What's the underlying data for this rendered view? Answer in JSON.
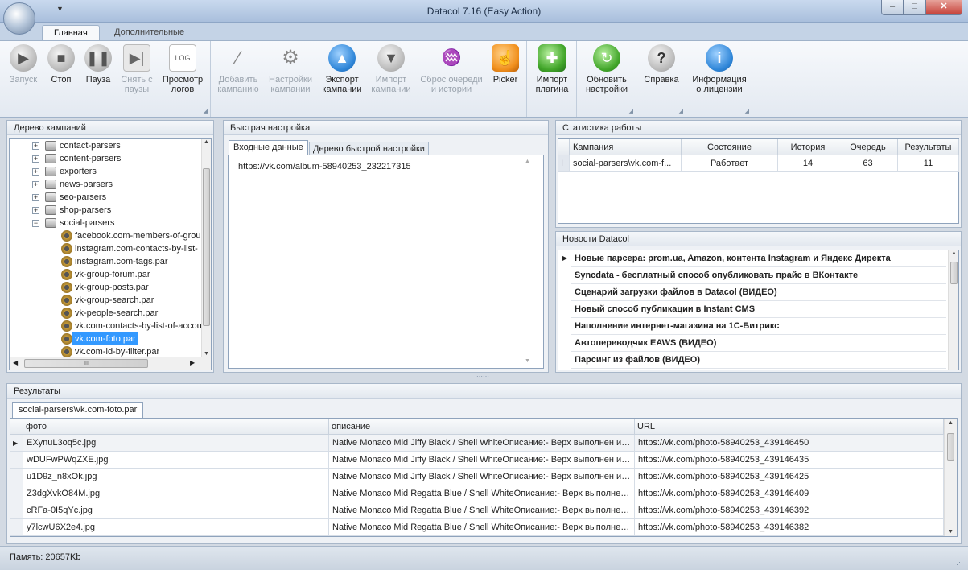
{
  "window": {
    "title": "Datacol 7.16 (Easy Action)",
    "minimize": "–",
    "maximize": "□",
    "close": "✕"
  },
  "ribbon": {
    "tabs": [
      "Главная",
      "Дополнительные"
    ],
    "buttons": {
      "start": {
        "line1": "Запуск",
        "line2": "",
        "icon": "play-icon"
      },
      "stop": {
        "line1": "Стоп",
        "line2": "",
        "icon": "stop-icon"
      },
      "pause": {
        "line1": "Пауза",
        "line2": "",
        "icon": "pause-icon"
      },
      "unpause": {
        "line1": "Снять с",
        "line2": "паузы",
        "icon": "resume-icon"
      },
      "logs": {
        "line1": "Просмотр",
        "line2": "логов",
        "icon": "log-icon"
      },
      "add_campaign": {
        "line1": "Добавить",
        "line2": "кампанию",
        "icon": "magic-wand-icon"
      },
      "campaign_settings": {
        "line1": "Настройки",
        "line2": "кампании",
        "icon": "gear-icon"
      },
      "export": {
        "line1": "Экспорт",
        "line2": "кампании",
        "icon": "arrow-up-icon"
      },
      "import": {
        "line1": "Импорт",
        "line2": "кампании",
        "icon": "arrow-down-icon"
      },
      "reset_queue": {
        "line1": "Сброс очереди",
        "line2": "и истории",
        "icon": "broom-icon"
      },
      "picker": {
        "line1": "Picker",
        "line2": "",
        "icon": "hand-pointer-icon"
      },
      "import_plugin": {
        "line1": "Импорт",
        "line2": "плагина",
        "icon": "puzzle-icon"
      },
      "update_settings": {
        "line1": "Обновить",
        "line2": "настройки",
        "icon": "refresh-icon"
      },
      "help": {
        "line1": "Справка",
        "line2": "",
        "icon": "help-icon"
      },
      "license": {
        "line1": "Информация",
        "line2": "о лицензии",
        "icon": "info-icon"
      }
    }
  },
  "tree_panel": {
    "title": "Дерево кампаний",
    "folders": [
      "contact-parsers",
      "content-parsers",
      "exporters",
      "news-parsers",
      "seo-parsers",
      "shop-parsers",
      "social-parsers"
    ],
    "items": [
      "facebook.com-members-of-grou",
      "instagram.com-contacts-by-list-",
      "instagram.com-tags.par",
      "vk-group-forum.par",
      "vk-group-posts.par",
      "vk-group-search.par",
      "vk-people-search.par",
      "vk.com-contacts-by-list-of-accou",
      "vk.com-foto.par",
      "vk.com-id-by-filter.par"
    ],
    "selected": "vk.com-foto.par",
    "hscroll_grip": "III"
  },
  "quick_settings": {
    "title": "Быстрая настройка",
    "tabs": [
      "Входные данные",
      "Дерево быстрой настройки"
    ],
    "input_text": "https://vk.com/album-58940253_232217315"
  },
  "stats": {
    "title": "Статистика работы",
    "columns": [
      "Кампания",
      "Состояние",
      "История",
      "Очередь",
      "Результаты"
    ],
    "row_marker": "I",
    "rows": [
      [
        "social-parsers\\vk.com-f...",
        "Работает",
        "14",
        "63",
        "11"
      ]
    ]
  },
  "news": {
    "title": "Новости Datacol",
    "items": [
      "Новые парсера: prom.ua, Amazon, контента Instagram и Яндекс Директа",
      "Syncdata - бесплатный способ опубликовать прайс в ВКонтакте",
      "Сценарий загрузки файлов в Datacol (ВИДЕО)",
      "Новый способ публикации в Instant CMS",
      "Наполнение интернет-магазина на 1С-Битрикс",
      "Автопереводчик EAWS (ВИДЕО)",
      "Парсинг из файлов (ВИДЕО)"
    ]
  },
  "results": {
    "title": "Результаты",
    "tab": "social-parsers\\vk.com-foto.par",
    "columns": [
      "фото",
      "описание",
      "URL"
    ],
    "rows": [
      [
        "EXynuL3oq5c.jpg",
        "Native Monaco Mid Jiffy Black / Shell WhiteОписание:- Верх выполнен из ...",
        "https://vk.com/photo-58940253_439146450"
      ],
      [
        "wDUFwPWqZXE.jpg",
        "Native Monaco Mid Jiffy Black / Shell WhiteОписание:- Верх выполнен из ...",
        "https://vk.com/photo-58940253_439146435"
      ],
      [
        "u1D9z_n8xOk.jpg",
        "Native Monaco Mid Jiffy Black / Shell WhiteОписание:- Верх выполнен из ...",
        "https://vk.com/photo-58940253_439146425"
      ],
      [
        "Z3dgXvkO84M.jpg",
        "Native Monaco Mid Regatta Blue / Shell WhiteОписание:- Верх выполнен ...",
        "https://vk.com/photo-58940253_439146409"
      ],
      [
        "cRFa-0I5qYc.jpg",
        "Native Monaco Mid Regatta Blue / Shell WhiteОписание:- Верх выполнен ...",
        "https://vk.com/photo-58940253_439146392"
      ],
      [
        "y7lcwU6X2e4.jpg",
        "Native Monaco Mid Regatta Blue / Shell WhiteОписание:- Верх выполнен ...",
        "https://vk.com/photo-58940253_439146382"
      ]
    ]
  },
  "status": {
    "memory": "Память: 20657Kb"
  },
  "colors": {
    "accent": "#3399ff",
    "ribbon_bg": "#e9eef5",
    "panel_bg": "#eef1f5"
  }
}
